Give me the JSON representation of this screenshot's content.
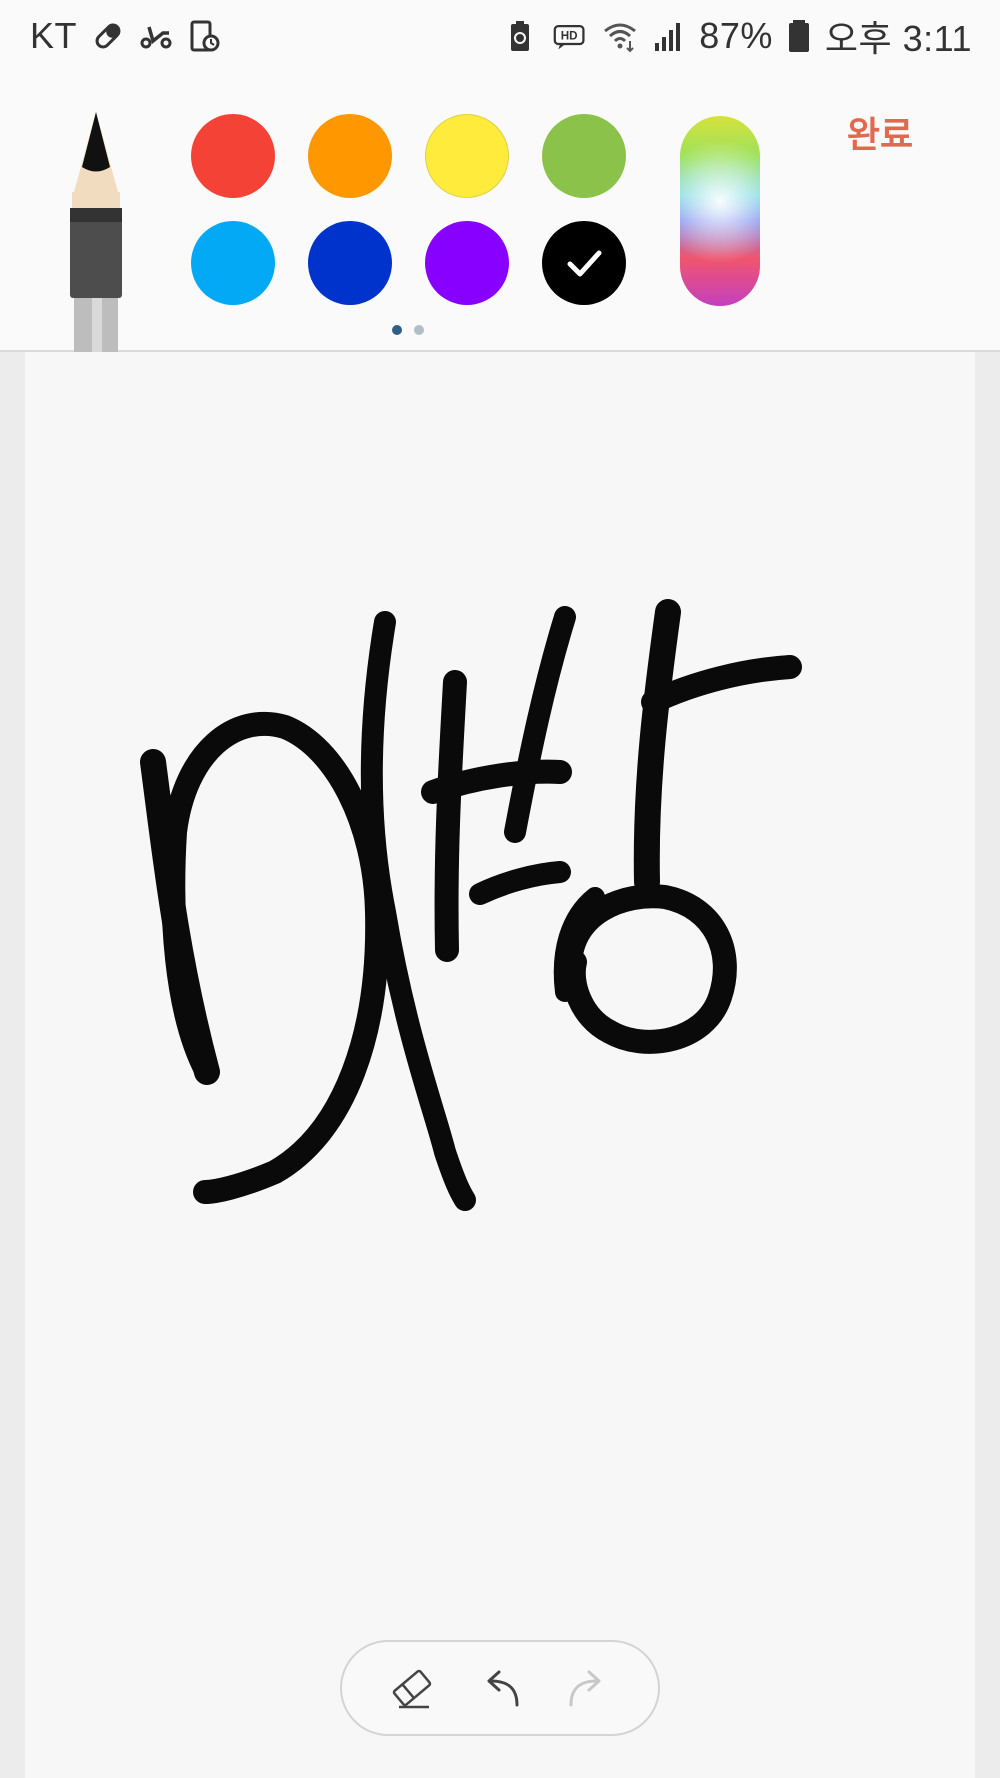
{
  "status_bar": {
    "carrier": "KT",
    "battery_percent": "87%",
    "time": "오후 3:11",
    "hd_badge": "HD",
    "left_icons": [
      "bandage-icon",
      "scooter-icon",
      "screen-timer-icon"
    ],
    "right_icons": [
      "battery-recycle-icon",
      "hd-voice-icon",
      "wifi-icon",
      "signal-icon",
      "battery-icon"
    ]
  },
  "toolbar": {
    "done_label": "완료",
    "selected_color": "#000000",
    "colors": [
      {
        "name": "red",
        "hex": "#f44336"
      },
      {
        "name": "orange",
        "hex": "#ff9800"
      },
      {
        "name": "yellow",
        "hex": "#ffeb3b"
      },
      {
        "name": "green",
        "hex": "#8bc34a"
      },
      {
        "name": "light-blue",
        "hex": "#03a9f4"
      },
      {
        "name": "blue",
        "hex": "#0033cc"
      },
      {
        "name": "purple",
        "hex": "#8800ff"
      },
      {
        "name": "black",
        "hex": "#000000"
      }
    ],
    "page_count": 2,
    "current_page": 1
  },
  "tools": {
    "eraser_icon": "eraser-icon",
    "undo_icon": "undo-icon",
    "redo_icon": "redo-icon",
    "redo_enabled": false
  },
  "accent": "#e2694f"
}
